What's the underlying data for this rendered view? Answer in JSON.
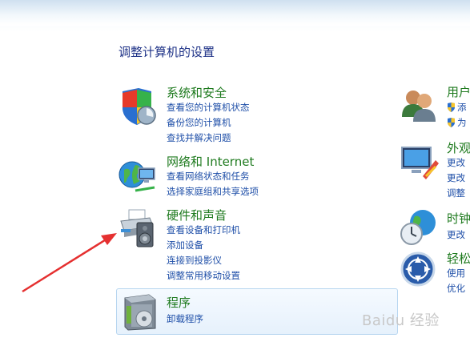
{
  "page_title": "调整计算机的设置",
  "categories": {
    "system": {
      "title": "系统和安全",
      "links": [
        "查看您的计算机状态",
        "备份您的计算机",
        "查找并解决问题"
      ]
    },
    "network": {
      "title": "网络和 Internet",
      "links": [
        "查看网络状态和任务",
        "选择家庭组和共享选项"
      ]
    },
    "hardware": {
      "title": "硬件和声音",
      "links": [
        "查看设备和打印机",
        "添加设备",
        "连接到投影仪",
        "调整常用移动设置"
      ]
    },
    "programs": {
      "title": "程序",
      "links": [
        "卸载程序"
      ]
    },
    "users": {
      "title": "用户",
      "links": [
        "添",
        "为"
      ]
    },
    "appearance": {
      "title": "外观",
      "links": [
        "更改",
        "更改",
        "调整"
      ]
    },
    "clock": {
      "title": "时钟",
      "links": [
        "更改"
      ]
    },
    "ease": {
      "title": "轻松",
      "links": [
        "使用",
        "优化"
      ]
    }
  },
  "watermark": "Baidu 经验",
  "colors": {
    "title_text": "#1e3287",
    "category_title": "#1e7a1e",
    "link_text": "#1f4fa8",
    "annotation_arrow": "#e53030"
  },
  "icons": {
    "system": "shield-icon",
    "network": "network-globe-icon",
    "hardware": "printer-speaker-icon",
    "programs": "program-box-icon",
    "users": "users-icon",
    "appearance": "display-icon",
    "clock": "clock-globe-icon",
    "ease": "ease-of-access-icon"
  }
}
